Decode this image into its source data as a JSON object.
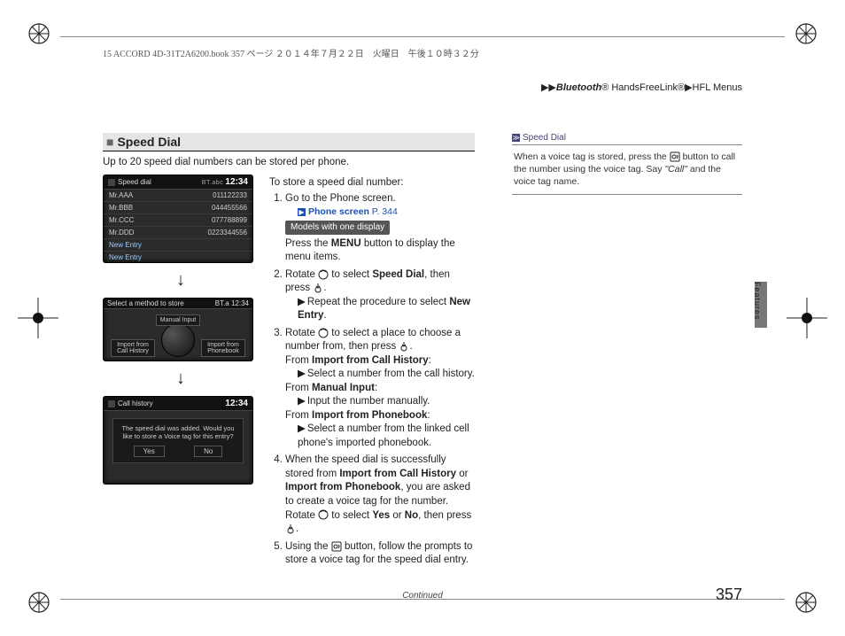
{
  "docinfo": "15 ACCORD 4D-31T2A6200.book  357 ページ  ２０１４年７月２２日　火曜日　午後１０時３２分",
  "breadcrumb": {
    "seg1_prefix": "Bluetooth",
    "seg1_suffix": "® HandsFreeLink®",
    "seg2": "HFL Menus"
  },
  "section_title": "Speed Dial",
  "intro": "Up to 20 speed dial numbers can be stored per phone.",
  "to_store": "To store a speed dial number:",
  "step1": "Go to the Phone screen.",
  "ref_phone_screen": "Phone screen",
  "ref_phone_screen_page": "P. 344",
  "pill_one_display": "Models with one display",
  "press_menu": "Press the MENU button to display the menu items.",
  "step2_pre": "Rotate ",
  "step2_mid": " to select ",
  "step2_bold": "Speed Dial",
  "step2_post": ", then press ",
  "step2_post2": ".",
  "step2_sub_pre": "Repeat the procedure to select ",
  "step2_sub_bold": "New Entry",
  "step2_sub_post": ".",
  "step3_pre": "Rotate ",
  "step3_mid": " to select a place to choose a number from, then press ",
  "step3_post": ".",
  "from_ich_label": "From ",
  "from_ich_bold": "Import from Call History",
  "from_ich_colon": ":",
  "from_ich_sub": "Select a number from the call history.",
  "from_mi_label": "From ",
  "from_mi_bold": "Manual Input",
  "from_mi_colon": ":",
  "from_mi_sub": "Input the number manually.",
  "from_ipb_label": "From ",
  "from_ipb_bold": "Import from Phonebook",
  "from_ipb_colon": ":",
  "from_ipb_sub": "Select a number from the linked cell phone's imported phonebook.",
  "step4_pre": "When the speed dial is successfully stored from ",
  "step4_b1": "Import from Call History",
  "step4_or": " or ",
  "step4_b2": "Import from Phonebook",
  "step4_mid": ", you are asked to create a voice tag for the number. Rotate ",
  "step4_mid2": " to select ",
  "step4_yes": "Yes",
  "step4_or2": " or ",
  "step4_no": "No",
  "step4_post": ", then press ",
  "step4_post2": ".",
  "step5_pre": "Using the ",
  "step5_post": " button, follow the prompts to store a voice tag for the speed dial entry.",
  "sidenote_title": "Speed Dial",
  "sidenote_body_pre": "When a voice tag is stored, press the ",
  "sidenote_body_post": " button to call the number using the voice tag. Say ",
  "sidenote_call": "\"Call\"",
  "sidenote_body_end": " and the voice tag name.",
  "screens": {
    "s1": {
      "title": "Speed dial",
      "bt": "BT.abc",
      "time": "12:34",
      "rows": [
        {
          "name": "Mr.AAA",
          "num": "011122233"
        },
        {
          "name": "Mr.BBB",
          "num": "044455566"
        },
        {
          "name": "Mr.CCC",
          "num": "077788899"
        },
        {
          "name": "Mr.DDD",
          "num": "0223344556"
        }
      ],
      "new1": "New Entry",
      "new2": "New Entry"
    },
    "s2": {
      "title": "Select a method to store",
      "bt": "BT.a",
      "time": "12:34",
      "manual": "Manual Input",
      "ich": "Import from Call History",
      "ipb": "Import from Phonebook"
    },
    "s3": {
      "title": "Call history",
      "time": "12:34",
      "msg": "The speed dial was added. Would you like to store a Voice tag for this entry?",
      "yes": "Yes",
      "no": "No"
    }
  },
  "edge_tab": "Features",
  "continued": "Continued",
  "page_number": "357"
}
